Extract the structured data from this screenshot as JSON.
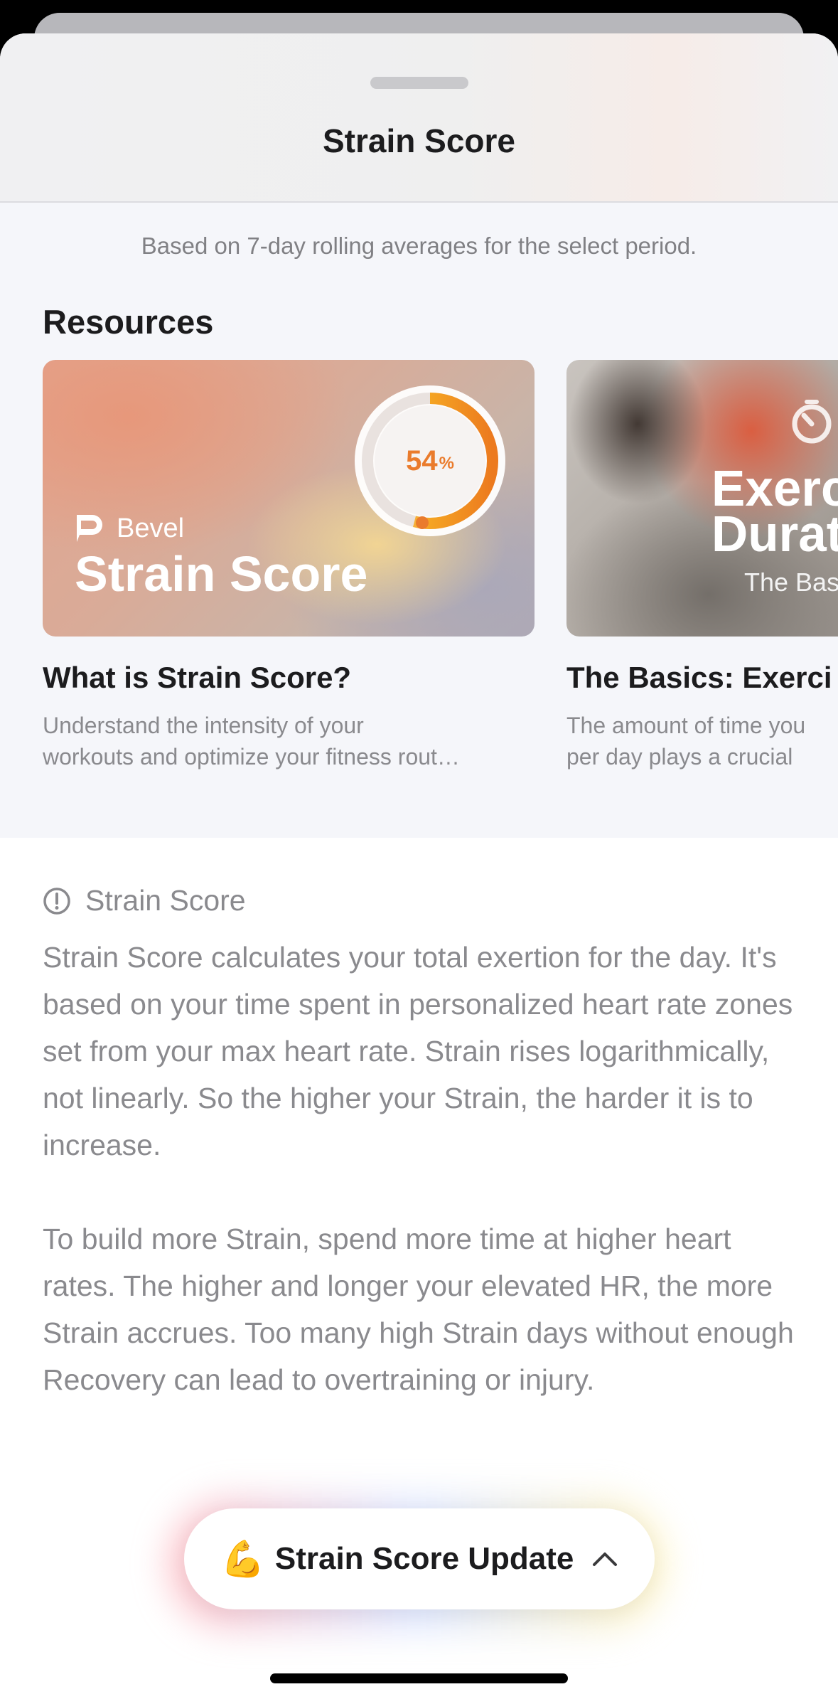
{
  "sheet": {
    "title": "Strain Score",
    "subtitle": "Based on 7-day rolling averages for the select period."
  },
  "resources": {
    "heading": "Resources",
    "cards": [
      {
        "brand": "Bevel",
        "thumb_title": "Strain Score",
        "gauge_value": "54",
        "gauge_unit": "%",
        "gauge_fraction": 0.54,
        "title": "What is Strain Score?",
        "desc_line1": "Understand the intensity of your",
        "desc_line2": "workouts and optimize your fitness rout…"
      },
      {
        "thumb_title": "Exerc\nDurat",
        "thumb_sub": "The Bas",
        "title": "The Basics: Exerci",
        "desc_line1": "The amount of time you",
        "desc_line2": "per day plays a crucial"
      }
    ]
  },
  "info": {
    "title": "Strain Score",
    "paragraph1": "Strain Score calculates your total exertion for the day. It's based on your time spent in personalized heart rate zones set from your max heart rate. Strain rises logarithmically, not linearly. So the higher your Strain, the harder it is to increase.",
    "paragraph2": "To build more Strain, spend more time at higher heart rates. The higher and longer your elevated HR, the more Strain accrues. Too many high Strain days without enough Recovery can lead to overtraining or injury."
  },
  "update_pill": {
    "emoji": "💪",
    "label": "Strain Score Update",
    "icon": "chevron-up-icon"
  },
  "colors": {
    "accent_orange": "#ea7b2c",
    "gauge_yellow": "#f7c24a",
    "secondary_text": "#8a8a8e"
  }
}
